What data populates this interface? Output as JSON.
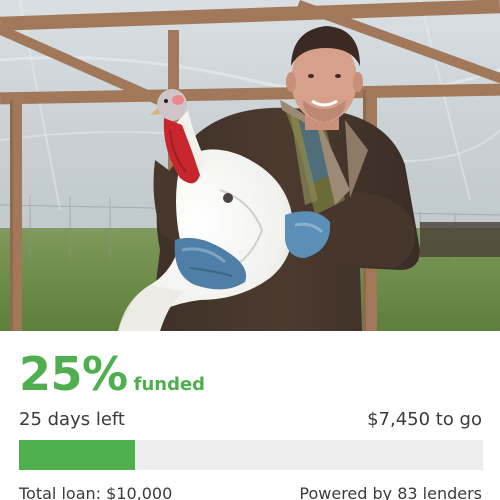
{
  "loan": {
    "percent_funded": "25%",
    "percent_funded_value": 0.25,
    "funded_label": "funded",
    "days_left": "25 days left",
    "amount_to_go": "$7,450 to go",
    "total_loan": "Total loan: $10,000",
    "powered_by": "Powered by 83 lenders"
  },
  "colors": {
    "accent_green": "#4faf4e",
    "track_gray": "#ededed",
    "text": "#3b3b3b"
  }
}
